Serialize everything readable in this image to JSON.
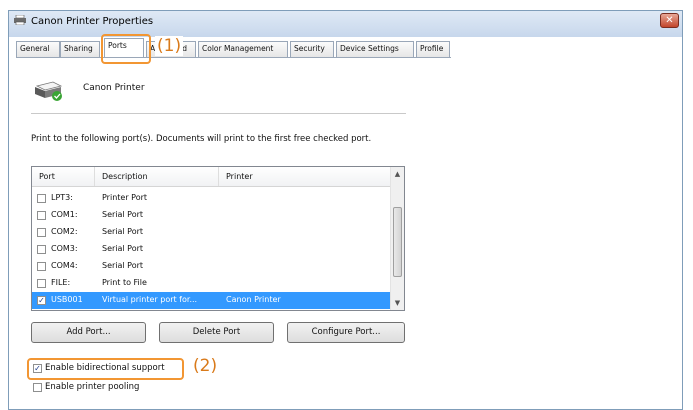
{
  "window": {
    "title": "Canon Printer Properties",
    "close_glyph": "✕"
  },
  "tabs": [
    "General",
    "Sharing",
    "Ports",
    "Advanced",
    "Color Management",
    "Security",
    "Device Settings",
    "Profile"
  ],
  "tab_labels": {
    "general": "General",
    "sharing": "Sharing",
    "ports": "Ports",
    "advanced": "Advanced",
    "color": "Color Management",
    "security": "Security",
    "device": "Device Settings",
    "profile": "Profile"
  },
  "callouts": {
    "one": "(1)",
    "two": "(2)"
  },
  "printer": {
    "name": "Canon Printer",
    "icon": "printer-icon"
  },
  "instruction": "Print to the following port(s). Documents will print to the first free checked port.",
  "table": {
    "headers": {
      "port": "Port",
      "description": "Description",
      "printer": "Printer"
    },
    "rows": [
      {
        "port": "LPT3:",
        "description": "Printer Port",
        "printer": "",
        "checked": false
      },
      {
        "port": "COM1:",
        "description": "Serial Port",
        "printer": "",
        "checked": false
      },
      {
        "port": "COM2:",
        "description": "Serial Port",
        "printer": "",
        "checked": false
      },
      {
        "port": "COM3:",
        "description": "Serial Port",
        "printer": "",
        "checked": false
      },
      {
        "port": "COM4:",
        "description": "Serial Port",
        "printer": "",
        "checked": false
      },
      {
        "port": "FILE:",
        "description": "Print to File",
        "printer": "",
        "checked": false
      },
      {
        "port": "USB001",
        "description": "Virtual printer port for...",
        "printer": "Canon Printer",
        "checked": true
      }
    ]
  },
  "buttons": {
    "add": "Add Port...",
    "delete": "Delete Port",
    "configure": "Configure Port..."
  },
  "options": {
    "bidirectional": {
      "label": "Enable bidirectional support",
      "checked": true
    },
    "pooling": {
      "label": "Enable printer pooling",
      "checked": false
    }
  },
  "check_glyph": "✓",
  "colors": {
    "accent": "#f29633",
    "selection": "#3399ff",
    "close": "#c2452b"
  }
}
